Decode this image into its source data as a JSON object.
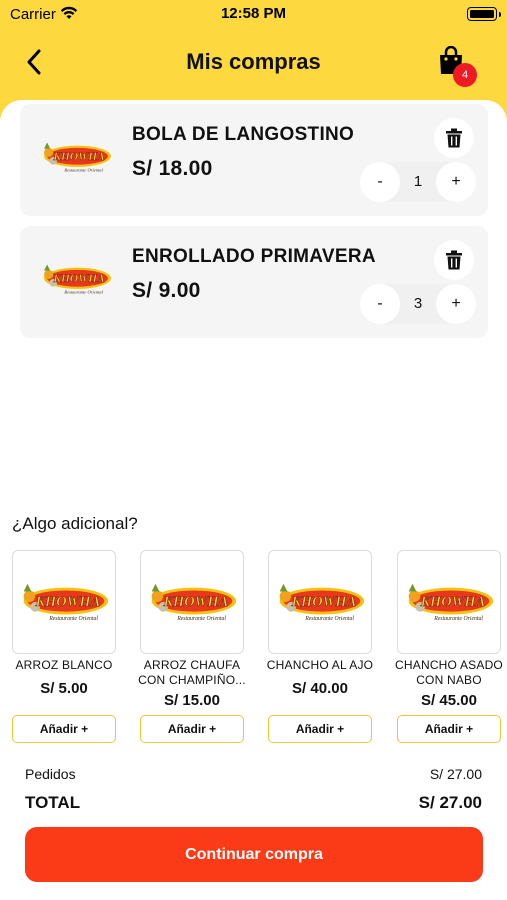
{
  "status_bar": {
    "carrier": "Carrier",
    "time": "12:58 PM"
  },
  "header": {
    "title": "Mis compras",
    "cart_count": "4"
  },
  "logo": {
    "brand": "KHOWHA",
    "tagline": "Restaurante Oriental"
  },
  "cart_items": [
    {
      "name": "BOLA DE LANGOSTINO",
      "price": "S/ 18.00",
      "quantity": "1",
      "minus": "-",
      "plus": "+"
    },
    {
      "name": "ENROLLADO PRIMAVERA",
      "price": "S/ 9.00",
      "quantity": "3",
      "minus": "-",
      "plus": "+"
    }
  ],
  "extras": {
    "title": "¿Algo adicional?",
    "items": [
      {
        "name": "ARROZ BLANCO",
        "price": "S/ 5.00",
        "add_label": "Añadir +"
      },
      {
        "name": "ARROZ CHAUFA CON CHAMPIÑO...",
        "price": "S/ 15.00",
        "add_label": "Añadir +"
      },
      {
        "name": "CHANCHO AL AJO",
        "price": "S/ 40.00",
        "add_label": "Añadir +"
      },
      {
        "name": "CHANCHO ASADO CON NABO",
        "price": "S/ 45.00",
        "add_label": "Añadir +"
      }
    ]
  },
  "summary": {
    "pedidos_label": "Pedidos",
    "pedidos_value": "S/ 27.00",
    "total_label": "TOTAL",
    "total_value": "S/ 27.00"
  },
  "continue_label": "Continuar compra",
  "colors": {
    "header_bg": "#fdd83f",
    "accent": "#fb3a18",
    "badge": "#ee1b24",
    "card_bg": "#f5f5f5"
  }
}
